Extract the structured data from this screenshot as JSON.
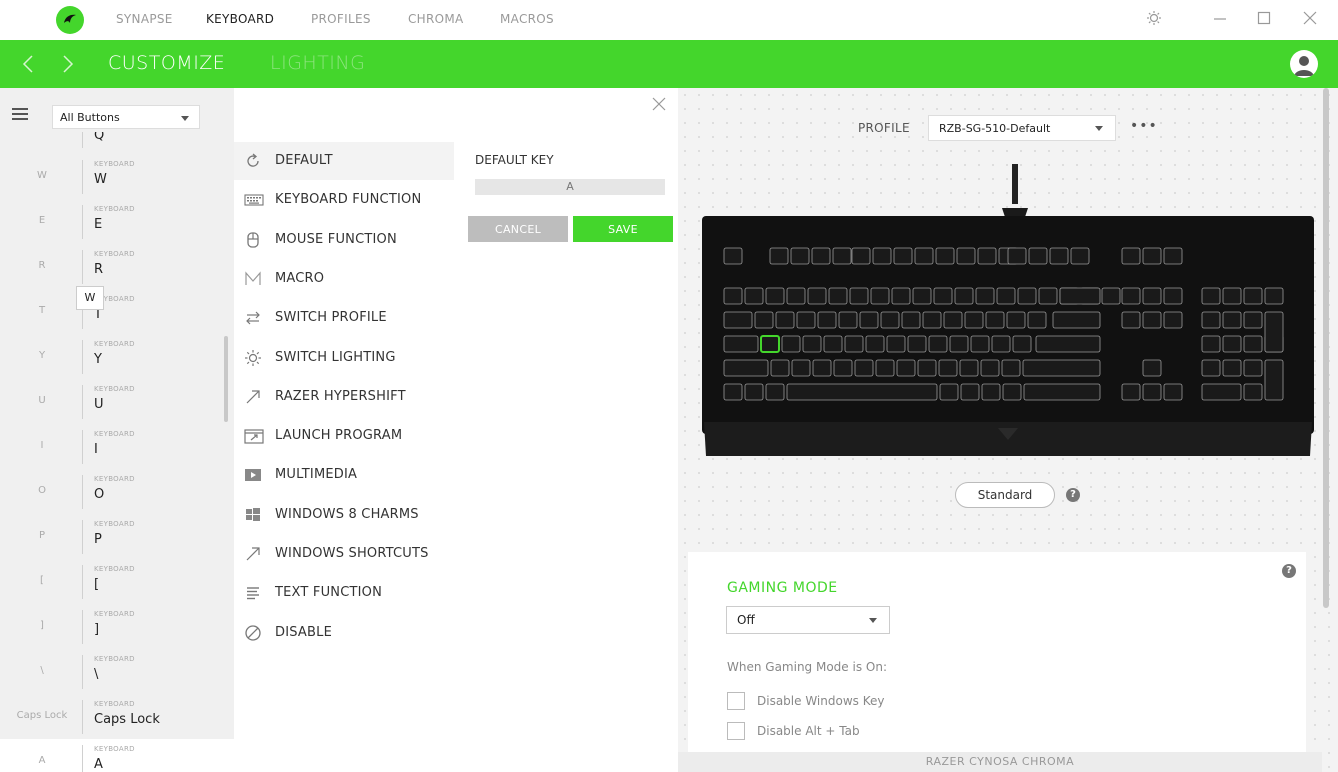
{
  "nav": {
    "tabs": [
      "SYNAPSE",
      "KEYBOARD",
      "PROFILES",
      "CHROMA",
      "MACROS"
    ],
    "active_tab": "KEYBOARD"
  },
  "subnav": {
    "tabs": [
      "CUSTOMIZE",
      "LIGHTING"
    ],
    "active_tab": "CUSTOMIZE"
  },
  "keylist": {
    "filter": "All Buttons",
    "partial_top": "Q",
    "tooltip": "W",
    "items": [
      {
        "name": "W",
        "type": "KEYBOARD",
        "value": "W"
      },
      {
        "name": "E",
        "type": "KEYBOARD",
        "value": "E"
      },
      {
        "name": "R",
        "type": "KEYBOARD",
        "value": "R"
      },
      {
        "name": "T",
        "type": "KEYBOARD",
        "value": "T"
      },
      {
        "name": "Y",
        "type": "KEYBOARD",
        "value": "Y"
      },
      {
        "name": "U",
        "type": "KEYBOARD",
        "value": "U"
      },
      {
        "name": "I",
        "type": "KEYBOARD",
        "value": "I"
      },
      {
        "name": "O",
        "type": "KEYBOARD",
        "value": "O"
      },
      {
        "name": "P",
        "type": "KEYBOARD",
        "value": "P"
      },
      {
        "name": "[",
        "type": "KEYBOARD",
        "value": "["
      },
      {
        "name": "]",
        "type": "KEYBOARD",
        "value": "]"
      },
      {
        "name": "\\",
        "type": "KEYBOARD",
        "value": "\\"
      },
      {
        "name": "Caps Lock",
        "type": "KEYBOARD",
        "value": "Caps Lock"
      },
      {
        "name": "A",
        "type": "KEYBOARD",
        "value": "A"
      }
    ]
  },
  "functions": {
    "items": [
      {
        "label": "DEFAULT",
        "icon": "reset-icon"
      },
      {
        "label": "KEYBOARD FUNCTION",
        "icon": "keyboard-icon"
      },
      {
        "label": "MOUSE FUNCTION",
        "icon": "mouse-icon"
      },
      {
        "label": "MACRO",
        "icon": "macro-icon"
      },
      {
        "label": "SWITCH PROFILE",
        "icon": "switch-arrows-icon"
      },
      {
        "label": "SWITCH LIGHTING",
        "icon": "lighting-icon"
      },
      {
        "label": "RAZER HYPERSHIFT",
        "icon": "diagonal-arrow-icon"
      },
      {
        "label": "LAUNCH PROGRAM",
        "icon": "launch-icon"
      },
      {
        "label": "MULTIMEDIA",
        "icon": "play-icon"
      },
      {
        "label": "WINDOWS 8 CHARMS",
        "icon": "windows-icon"
      },
      {
        "label": "WINDOWS SHORTCUTS",
        "icon": "diagonal-arrow-icon"
      },
      {
        "label": "TEXT FUNCTION",
        "icon": "text-lines-icon"
      },
      {
        "label": "DISABLE",
        "icon": "disable-icon"
      }
    ],
    "active": "DEFAULT"
  },
  "default_key": {
    "label": "DEFAULT KEY",
    "value": "A",
    "cancel": "CANCEL",
    "save": "SAVE"
  },
  "profile": {
    "label": "PROFILE",
    "value": "RZB-SG-510-Default",
    "more": "•••"
  },
  "keyboard": {
    "mode_button": "Standard",
    "selected_key": "A"
  },
  "gaming_mode": {
    "title": "GAMING MODE",
    "value": "Off",
    "subtitle": "When Gaming Mode is On:",
    "options": [
      "Disable Windows Key",
      "Disable Alt + Tab"
    ]
  },
  "device_name": "RAZER CYNOSA CHROMA",
  "colors": {
    "accent": "#44d62c",
    "panel_bg": "#f3f3f3"
  }
}
